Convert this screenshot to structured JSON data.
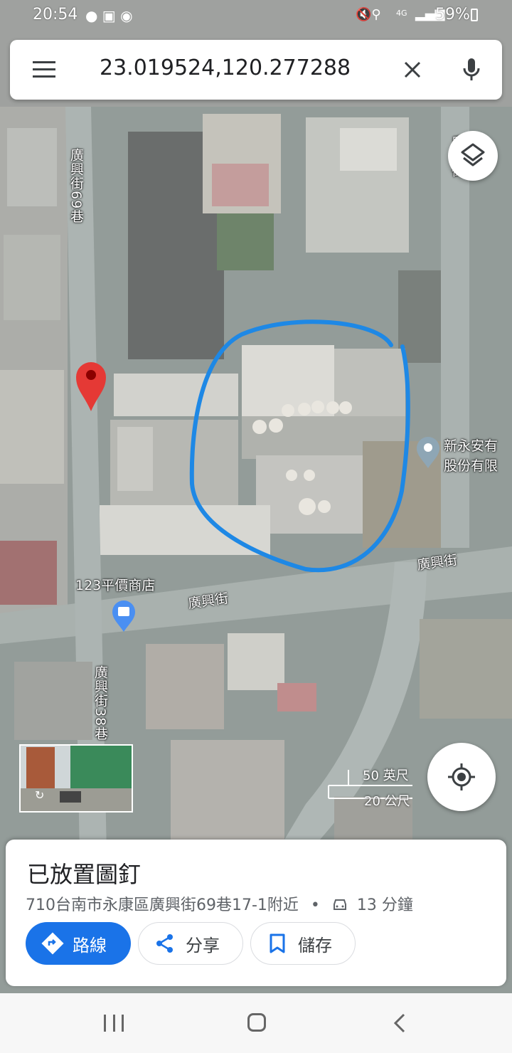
{
  "status_bar": {
    "time": "20:54",
    "battery": "59%",
    "network": "4G"
  },
  "search": {
    "query": "23.019524,120.277288",
    "menu_icon": "menu-icon",
    "clear_icon": "close-icon",
    "voice_icon": "mic-icon"
  },
  "map": {
    "streets": {
      "s1": "廣興街69巷",
      "s2": "廣興街",
      "s3": "廣興街",
      "s4": "廣興街38巷",
      "s5": "廣興街"
    },
    "pois": {
      "shop_name": "123平價商店",
      "company_line1": "新永安有",
      "company_line2": "股份有限"
    },
    "scale": {
      "imperial": "50 英尺",
      "metric": "20 公尺"
    },
    "annotation_color": "#1e88e5",
    "pin_color": "#e53935",
    "accent": "#1a73e8"
  },
  "sheet": {
    "title": "已放置圖釘",
    "address": "710台南市永康區廣興街69巷17-1附近",
    "separator": "•",
    "drive_time": "13 分鐘",
    "buttons": {
      "directions": "路線",
      "share": "分享",
      "save": "儲存"
    }
  }
}
